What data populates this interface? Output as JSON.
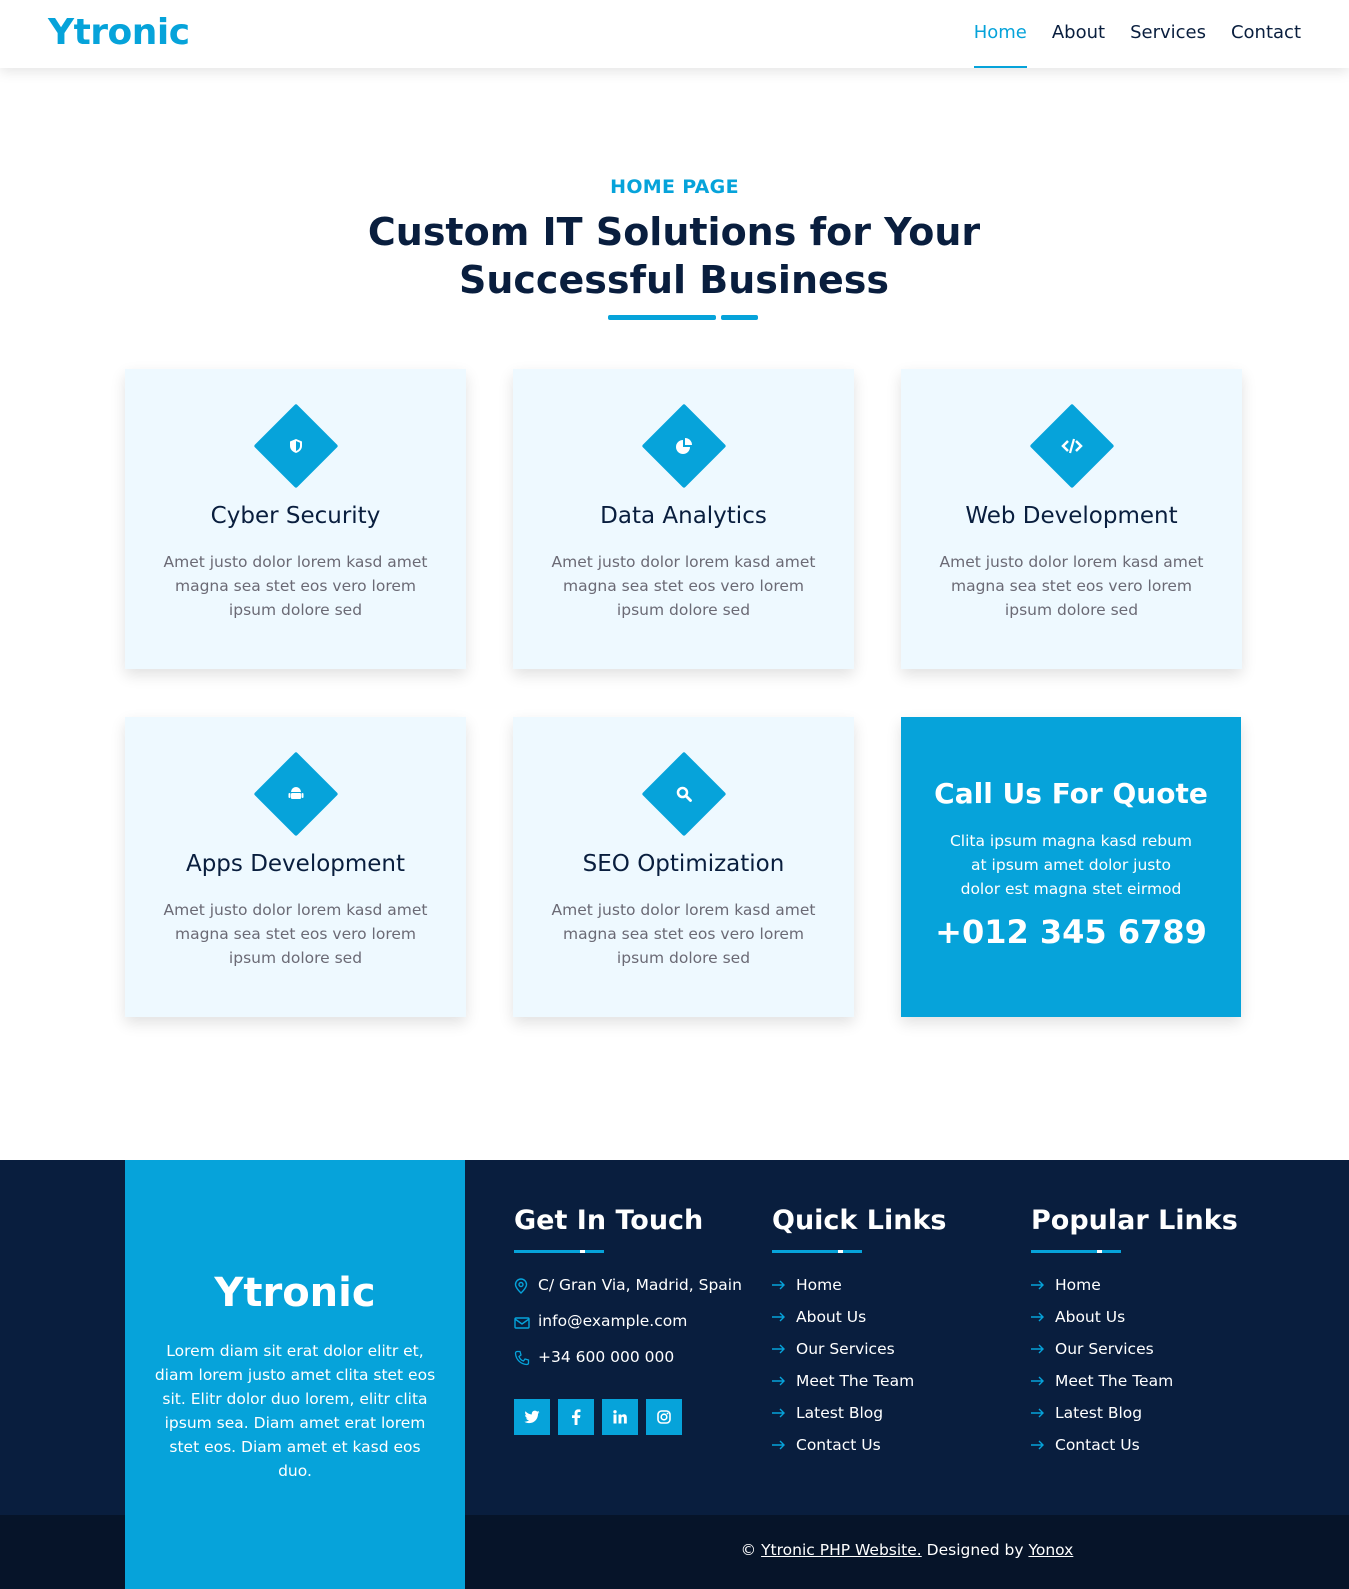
{
  "navbar": {
    "brand": "Ytronic",
    "links": [
      {
        "label": "Home",
        "active": true
      },
      {
        "label": "About",
        "active": false
      },
      {
        "label": "Services",
        "active": false
      },
      {
        "label": "Contact",
        "active": false
      }
    ]
  },
  "hero": {
    "eyebrow": "HOME PAGE",
    "heading": "Custom IT Solutions for Your Successful Business"
  },
  "services": [
    {
      "title": "Cyber Security",
      "icon": "shield-icon",
      "desc": "Amet justo dolor lorem kasd amet magna sea stet eos vero lorem ipsum dolore sed"
    },
    {
      "title": "Data Analytics",
      "icon": "chart-pie-icon",
      "desc": "Amet justo dolor lorem kasd amet magna sea stet eos vero lorem ipsum dolore sed"
    },
    {
      "title": "Web Development",
      "icon": "code-icon",
      "desc": "Amet justo dolor lorem kasd amet magna sea stet eos vero lorem ipsum dolore sed"
    },
    {
      "title": "Apps Development",
      "icon": "android-icon",
      "desc": "Amet justo dolor lorem kasd amet magna sea stet eos vero lorem ipsum dolore sed"
    },
    {
      "title": "SEO Optimization",
      "icon": "search-icon",
      "desc": "Amet justo dolor lorem kasd amet magna sea stet eos vero lorem ipsum dolore sed"
    }
  ],
  "quote": {
    "title": "Call Us For Quote",
    "desc": "Clita ipsum magna kasd rebum at ipsum amet dolor justo dolor est magna stet eirmod",
    "phone": "+012 345 6789"
  },
  "footer": {
    "brand": "Ytronic",
    "brand_desc": "Lorem diam sit erat dolor elitr et, diam lorem justo amet clita stet eos sit. Elitr dolor duo lorem, elitr clita ipsum sea. Diam amet erat lorem stet eos. Diam amet et kasd eos duo.",
    "get_in_touch": {
      "title": "Get In Touch",
      "address": "C/ Gran Via, Madrid, Spain",
      "email": "info@example.com",
      "phone": "+34 600 000 000",
      "socials": [
        "twitter-icon",
        "facebook-icon",
        "linkedin-icon",
        "instagram-icon"
      ]
    },
    "quick_links": {
      "title": "Quick Links",
      "items": [
        "Home",
        "About Us",
        "Our Services",
        "Meet The Team",
        "Latest Blog",
        "Contact Us"
      ]
    },
    "popular_links": {
      "title": "Popular Links",
      "items": [
        "Home",
        "About Us",
        "Our Services",
        "Meet The Team",
        "Latest Blog",
        "Contact Us"
      ]
    },
    "copyright": {
      "prefix": "©",
      "site": "Ytronic PHP Website.",
      "designed_by": "Designed by",
      "designer": "Yonox"
    }
  },
  "colors": {
    "primary": "#06a3da",
    "dark": "#091e3e",
    "darker": "#061429",
    "card_bg": "#eef9ff"
  }
}
